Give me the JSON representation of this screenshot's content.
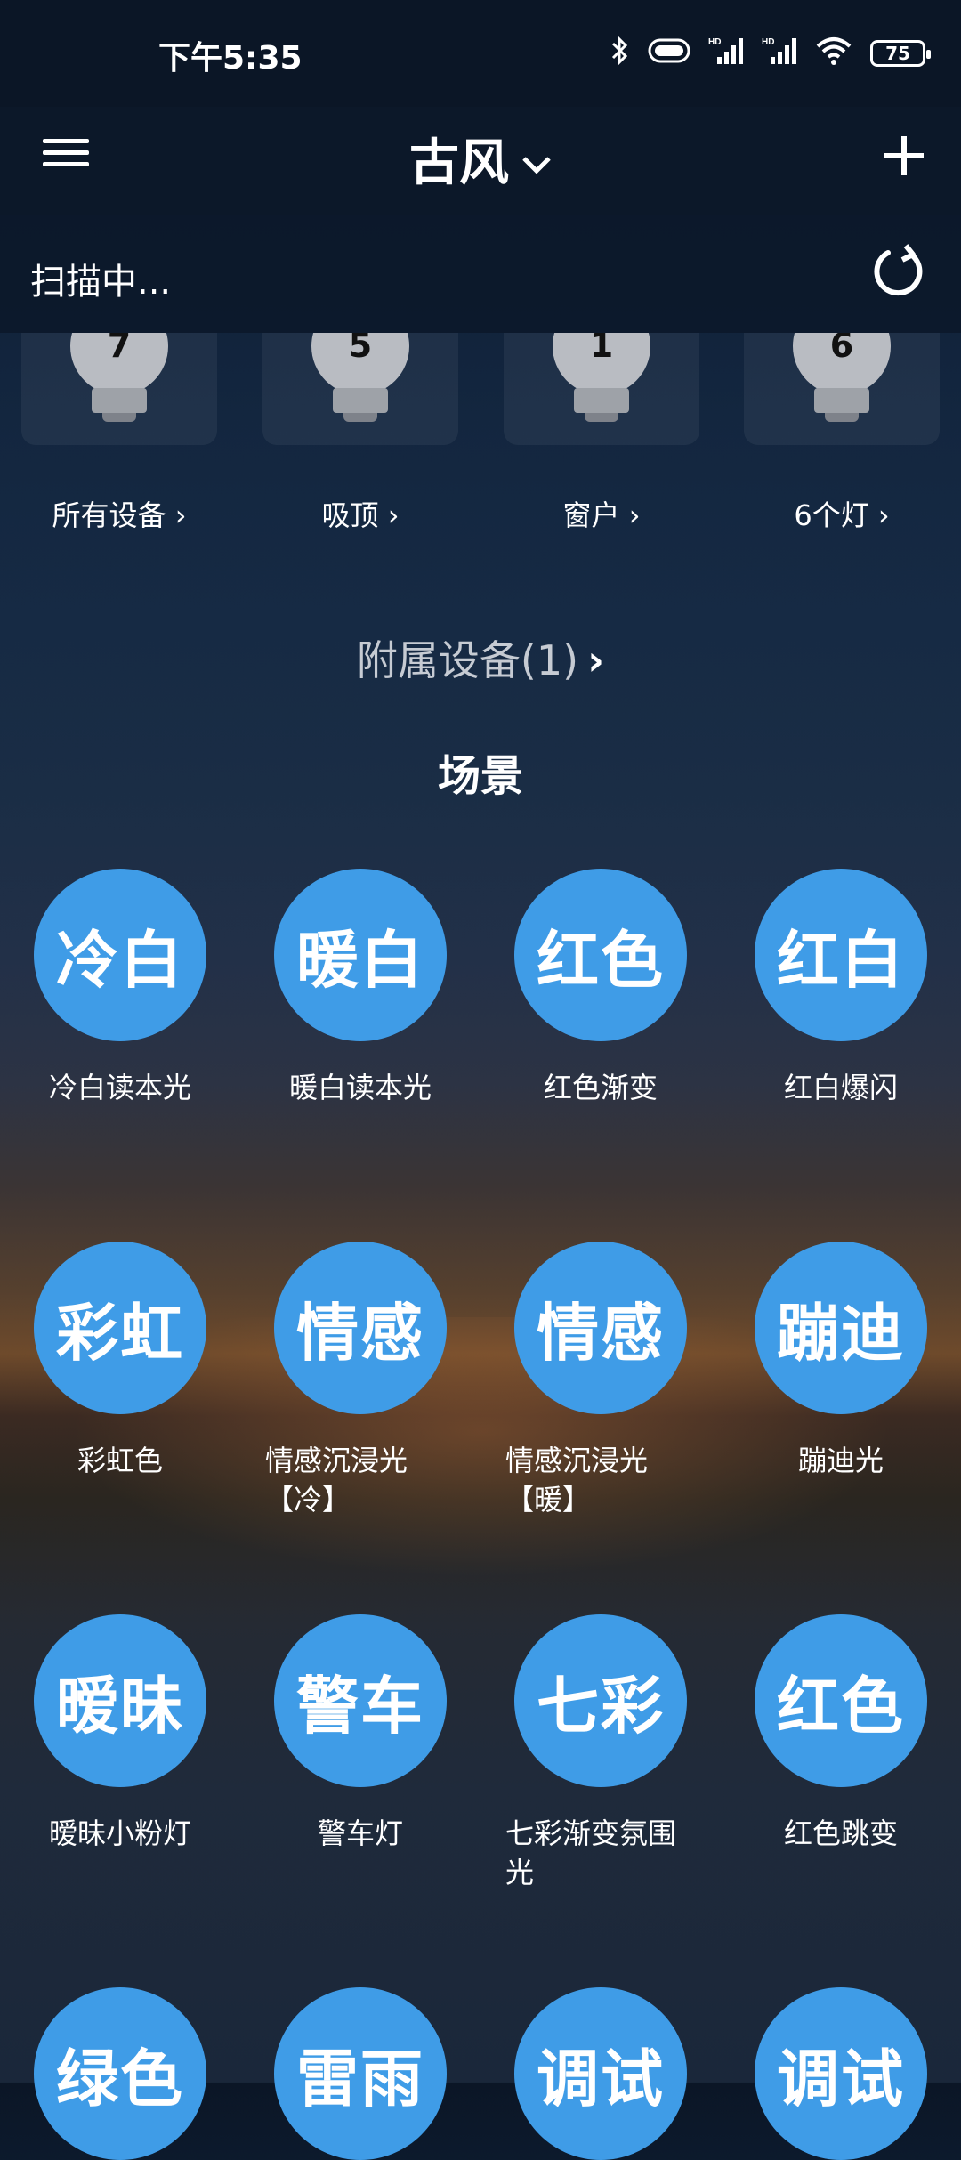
{
  "status": {
    "time": "下午5:35",
    "battery": "75",
    "icons": [
      "bluetooth-icon",
      "vibrate-icon",
      "signal-hd-icon",
      "signal-hd-icon",
      "wifi-icon",
      "battery-icon"
    ]
  },
  "header": {
    "title": "古风",
    "menu_icon": "menu-icon",
    "add_icon": "plus-icon"
  },
  "scan": {
    "text": "扫描中...",
    "refresh_icon": "refresh-icon"
  },
  "groups": [
    {
      "label": "所有设备",
      "count": "7"
    },
    {
      "label": "吸顶",
      "count": "5"
    },
    {
      "label": "窗户",
      "count": "1"
    },
    {
      "label": "6个灯",
      "count": "6"
    }
  ],
  "attached": {
    "label": "附属设备(1)"
  },
  "scenes_title": "场景",
  "scenes": [
    {
      "badge": "冷白",
      "label": "冷白读本光"
    },
    {
      "badge": "暖白",
      "label": "暖白读本光"
    },
    {
      "badge": "红色",
      "label": "红色渐变"
    },
    {
      "badge": "红白",
      "label": "红白爆闪"
    },
    {
      "badge": "彩虹",
      "label": "彩虹色"
    },
    {
      "badge": "情感",
      "label": "情感沉浸光【冷】"
    },
    {
      "badge": "情感",
      "label": "情感沉浸光【暖】"
    },
    {
      "badge": "蹦迪",
      "label": "蹦迪光"
    },
    {
      "badge": "暧昧",
      "label": "暧昧小粉灯"
    },
    {
      "badge": "警车",
      "label": "警车灯"
    },
    {
      "badge": "七彩",
      "label": "七彩渐变氛围光"
    },
    {
      "badge": "红色",
      "label": "红色跳变"
    },
    {
      "badge": "绿色",
      "label": ""
    },
    {
      "badge": "雷雨",
      "label": ""
    },
    {
      "badge": "调试",
      "label": ""
    },
    {
      "badge": "调试",
      "label": ""
    }
  ],
  "colors": {
    "scene_circle": "#3f9ce7",
    "header_bg": "#0c1829"
  }
}
